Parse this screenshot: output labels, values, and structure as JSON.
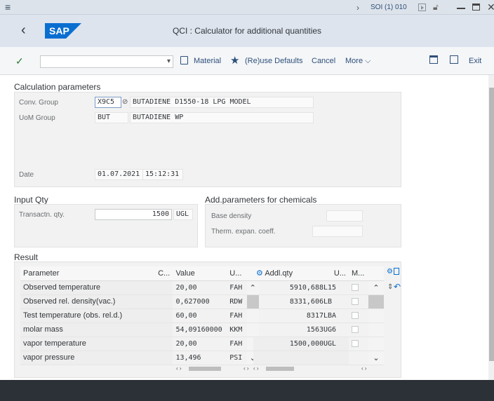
{
  "topbar": {
    "session": "SOI (1) 010"
  },
  "titlebar": {
    "logo": "SAP",
    "title": "QCI : Calculator for additional quantities"
  },
  "toolbar": {
    "material_label": "Material",
    "reuse_label": "(Re)use Defaults",
    "cancel_label": "Cancel",
    "more_label": "More",
    "exit_label": "Exit",
    "command_value": ""
  },
  "calc": {
    "heading": "Calculation parameters",
    "conv_group_label": "Conv. Group",
    "conv_group_value": "X9C5",
    "conv_group_desc": "BUTADIENE D1550-18 LPG MODEL",
    "uom_group_label": "UoM Group",
    "uom_group_value": "BUT",
    "uom_group_desc": "BUTADIENE WP",
    "date_label": "Date",
    "date_value": "01.07.2021",
    "time_value": "15:12:31"
  },
  "input": {
    "heading": "Input Qty",
    "qty_label": "Transactn. qty.",
    "qty_value": "1500",
    "qty_unit": "UGL"
  },
  "chem": {
    "heading": "Add.parameters for chemicals",
    "base_density_label": "Base density",
    "therm_label": "Therm. expan. coeff."
  },
  "result": {
    "heading": "Result",
    "headers": {
      "parameter": "Parameter",
      "c": "C...",
      "value": "Value",
      "u": "U...",
      "addl": "Addl.qty",
      "u2": "U...",
      "m": "M..."
    },
    "rows": [
      {
        "param": "Observed temperature",
        "value": "20,00",
        "unit": "FAH"
      },
      {
        "param": "Observed rel. density(vac.)",
        "value": "0,627000",
        "unit": "RDW"
      },
      {
        "param": "Test temperature (obs. rel.d.)",
        "value": "60,00",
        "unit": "FAH"
      },
      {
        "param": "molar mass",
        "value": "54,09160000",
        "unit": "KKM"
      },
      {
        "param": "vapor temperature",
        "value": "20,00",
        "unit": "FAH"
      },
      {
        "param": "vapor pressure",
        "value": "13,496",
        "unit": "PSI"
      }
    ],
    "addl": [
      {
        "qty": "5910,688",
        "unit": "L15"
      },
      {
        "qty": "8331,606",
        "unit": "LB"
      },
      {
        "qty": "8317",
        "unit": "LBA"
      },
      {
        "qty": "1563",
        "unit": "UG6"
      },
      {
        "qty": "1500,000",
        "unit": "UGL"
      }
    ]
  },
  "colors": {
    "accent": "#0a6ed1",
    "sap_blue": "#0a6ed1",
    "footer": "#2b3137"
  }
}
